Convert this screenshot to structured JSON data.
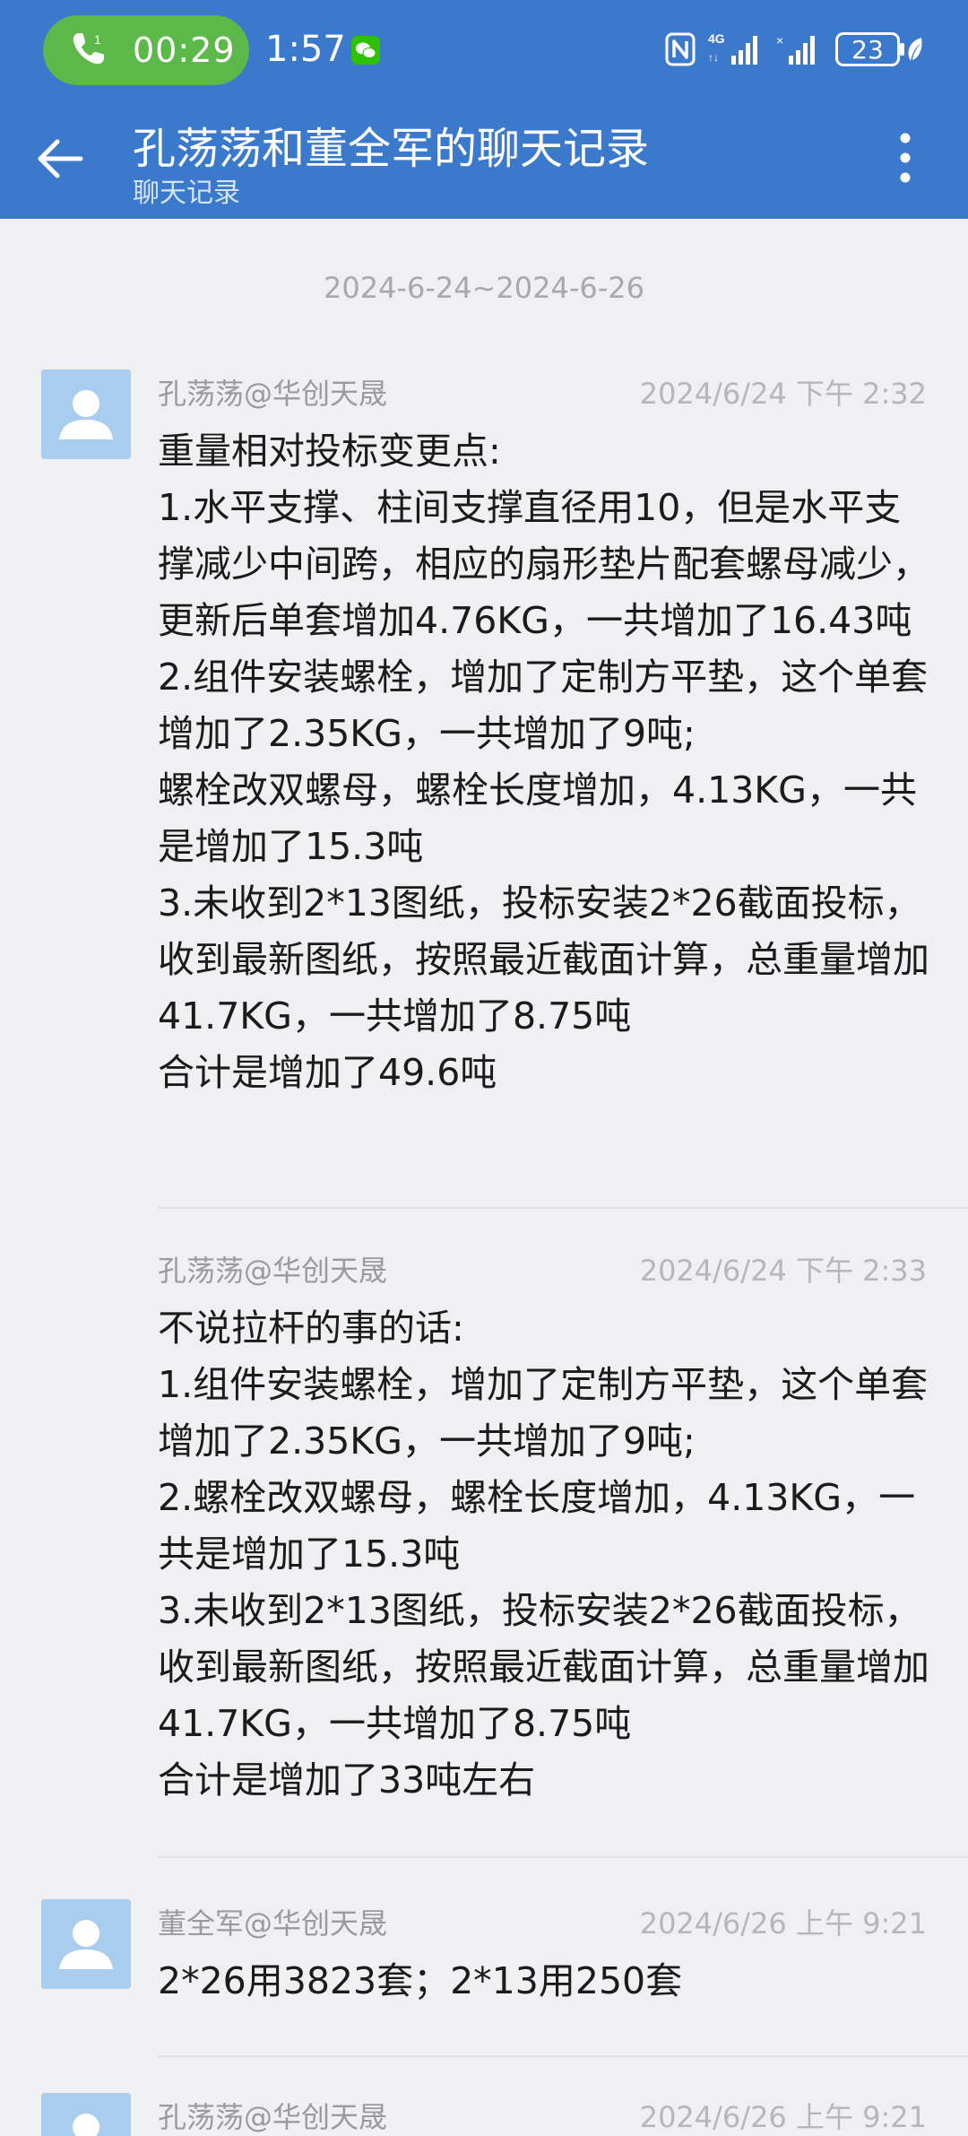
{
  "status_bar": {
    "call_timer": "00:29",
    "call_sim": "1",
    "clock": "1:57",
    "battery": "23",
    "icons": [
      "phone-icon",
      "wechat-icon",
      "nfc-icon",
      "signal-4g-icon",
      "signal-icon",
      "battery-icon",
      "leaf-icon"
    ]
  },
  "header": {
    "title": "孔荡荡和董全军的聊天记录",
    "subtitle": "聊天记录"
  },
  "date_range": "2024-6-24~2024-6-26",
  "messages": [
    {
      "sender": "孔荡荡@华创天晟",
      "time": "2024/6/24  下午 2:32",
      "text": "重量相对投标变更点:\n1.水平支撑、柱间支撑直径用10，但是水平支撑减少中间跨，相应的扇形垫片配套螺母减少，更新后单套增加4.76KG，一共增加了16.43吨\n2.组件安装螺栓，增加了定制方平垫，这个单套增加了2.35KG，一共增加了9吨;\n螺栓改双螺母，螺栓长度增加，4.13KG，一共是增加了15.3吨\n3.未收到2*13图纸，投标安装2*26截面投标，收到最新图纸，按照最近截面计算，总重量增加41.7KG，一共增加了8.75吨\n合计是增加了49.6吨"
    },
    {
      "sender": "孔荡荡@华创天晟",
      "time": "2024/6/24  下午 2:33",
      "text": "不说拉杆的事的话:\n1.组件安装螺栓，增加了定制方平垫，这个单套增加了2.35KG，一共增加了9吨;\n2.螺栓改双螺母，螺栓长度增加，4.13KG，一共是增加了15.3吨\n3.未收到2*13图纸，投标安装2*26截面投标，收到最新图纸，按照最近截面计算，总重量增加41.7KG，一共增加了8.75吨\n合计是增加了33吨左右"
    },
    {
      "sender": "董全军@华创天晟",
      "time": "2024/6/26  上午 9:21",
      "text": "2*26用3823套；2*13用250套"
    },
    {
      "sender": "孔荡荡@华创天晟",
      "time": "2024/6/26  上午 9:21",
      "text": ""
    }
  ]
}
